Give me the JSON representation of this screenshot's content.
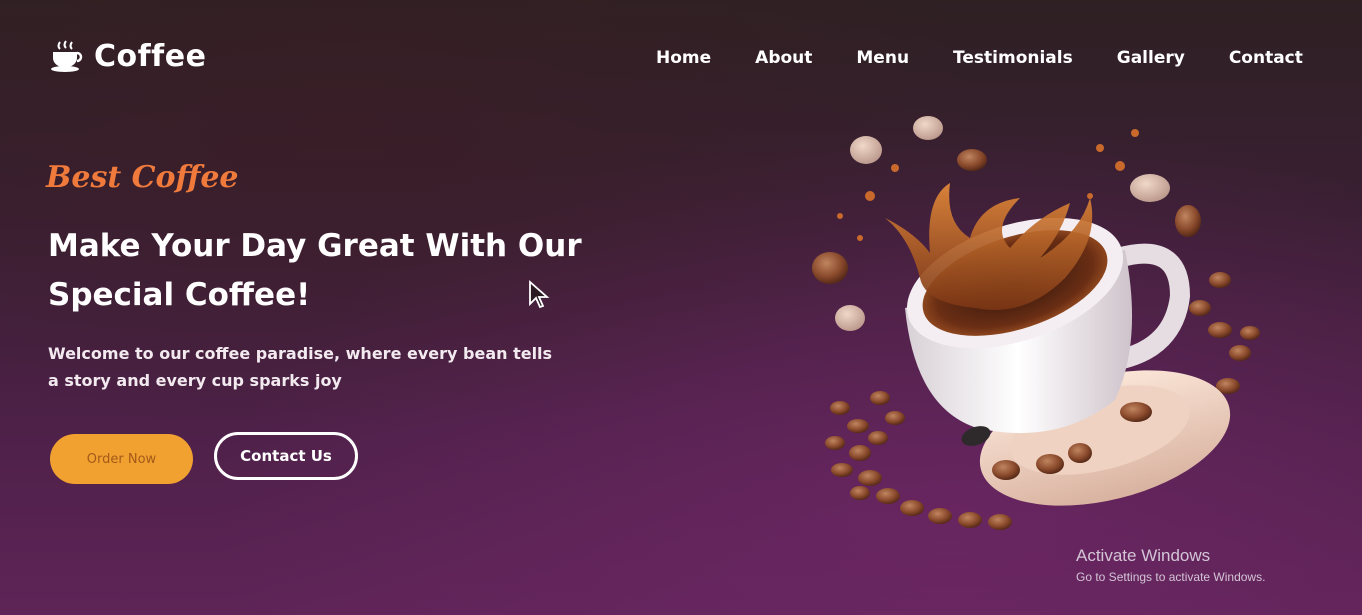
{
  "brand": {
    "name": "Coffee",
    "icon": "coffee-cup-icon"
  },
  "nav": {
    "items": [
      "Home",
      "About",
      "Menu",
      "Testimonials",
      "Gallery",
      "Contact"
    ]
  },
  "hero": {
    "tagline": "Best Coffee",
    "headline_line1": "Make Your Day Great With Our",
    "headline_line2": "Special Coffee!",
    "description_line1": "Welcome to our coffee paradise, where every bean tells",
    "description_line2": "a story and every cup sparks joy",
    "order_button": "Order Now",
    "contact_button": "Contact Us",
    "image": "coffee-cup-splash-illustration"
  },
  "watermark": {
    "title": "Activate Windows",
    "subtitle": "Go to Settings to activate Windows."
  },
  "colors": {
    "accent_orange": "#f07a3c",
    "button_orange": "#f0a130",
    "background_purple": "#5e2457"
  }
}
